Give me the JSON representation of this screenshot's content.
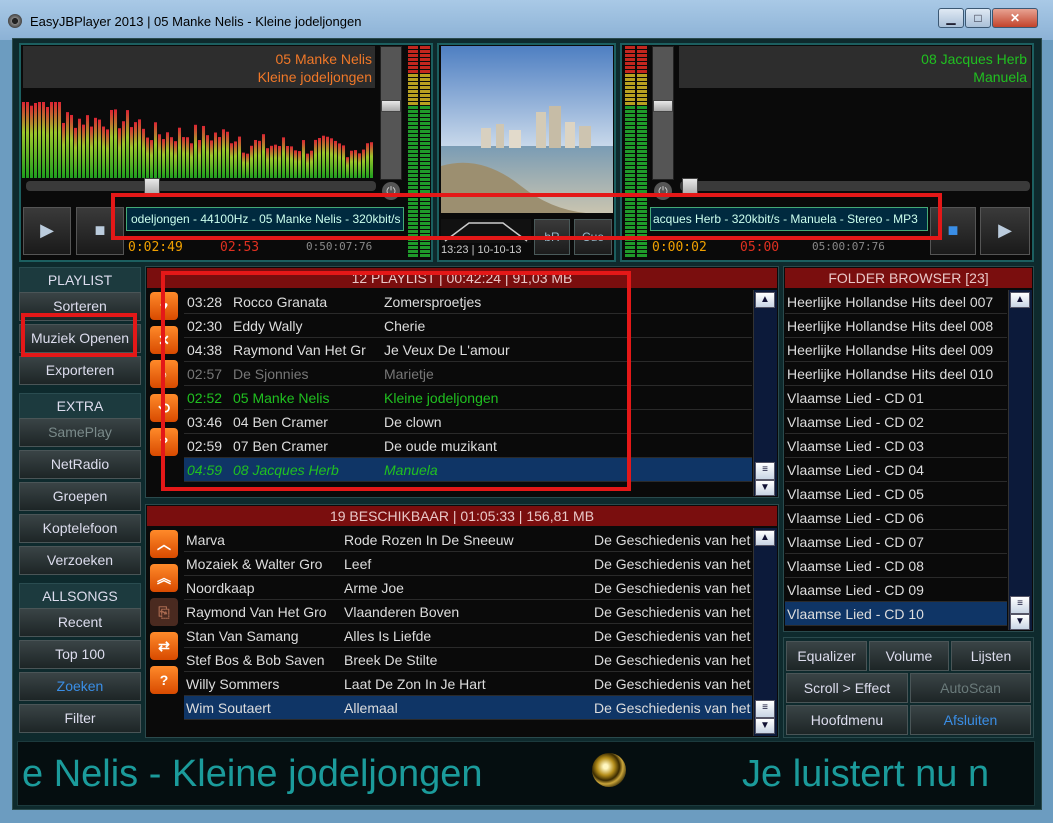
{
  "window": {
    "title": "EasyJBPlayer 2013 | 05 Manke Nelis - Kleine jodeljongen",
    "minimize": "▁",
    "maximize": "□",
    "close": "✕"
  },
  "deck_left": {
    "artist": "05 Manke Nelis",
    "title": "Kleine jodeljongen",
    "ticker": "odeljongen - 44100Hz - 05 Manke Nelis - 320kbit/s",
    "play_icon": "▶",
    "stop_icon": "■",
    "time_elapsed": "0:02:49",
    "time_total": "02:53",
    "time_remain": "0:50:07:76",
    "power_icon": "⏻"
  },
  "deck_right": {
    "artist": "08 Jacques Herb",
    "title": "Manuela",
    "ticker": "acques Herb - 320kbit/s - Manuela - Stereo - MP3",
    "play_icon": "▶",
    "stop_icon": "■",
    "time_elapsed": "0:00:02",
    "time_total": "05:00",
    "time_remain": "05:00:07:76",
    "power_icon": "⏻"
  },
  "center": {
    "clock": "13:23 | 10-10-13",
    "btn_br": "bR",
    "btn_cue": "Cue"
  },
  "playlist_menu": {
    "header": "PLAYLIST",
    "items": [
      "Sorteren",
      "Muziek Openen",
      "Exporteren"
    ]
  },
  "extra_menu": {
    "header": "EXTRA",
    "items": [
      "SamePlay",
      "NetRadio",
      "Groepen",
      "Koptelefoon",
      "Verzoeken"
    ]
  },
  "allsongs_menu": {
    "header": "ALLSONGS",
    "items": [
      "Recent",
      "Top 100",
      "Zoeken",
      "Filter"
    ]
  },
  "playlist": {
    "header": "12 PLAYLIST | 00:42:24 | 91,03 MB",
    "rows": [
      {
        "time": "03:28",
        "artist": "Rocco Granata",
        "title": "Zomersproetjes"
      },
      {
        "time": "02:30",
        "artist": "Eddy Wally",
        "title": "Cherie"
      },
      {
        "time": "04:38",
        "artist": "Raymond Van Het Gr",
        "title": "Je Veux De L'amour"
      },
      {
        "time": "02:57",
        "artist": "De Sjonnies",
        "title": "Marietje"
      },
      {
        "time": "02:52",
        "artist": "05 Manke Nelis",
        "title": "Kleine jodeljongen"
      },
      {
        "time": "03:46",
        "artist": "04 Ben Cramer",
        "title": "De clown"
      },
      {
        "time": "02:59",
        "artist": "07 Ben Cramer",
        "title": "De oude muzikant"
      },
      {
        "time": "04:59",
        "artist": "08 Jacques Herb",
        "title": "Manuela"
      }
    ],
    "side_icons": [
      "♥",
      "✕",
      "♪",
      "⟲",
      "?"
    ],
    "scroll_up": "▲",
    "scroll_down": "▼",
    "scroll_grip": "≡"
  },
  "available": {
    "header": "19 BESCHIKBAAR | 01:05:33 | 156,81 MB",
    "rows": [
      {
        "artist": "Marva",
        "title": "Rode Rozen In De Sneeuw",
        "album": "De Geschiedenis van het"
      },
      {
        "artist": "Mozaiek & Walter Gro",
        "title": "Leef",
        "album": "De Geschiedenis van het"
      },
      {
        "artist": "Noordkaap",
        "title": "Arme Joe",
        "album": "De Geschiedenis van het"
      },
      {
        "artist": "Raymond Van Het Gro",
        "title": "Vlaanderen Boven",
        "album": "De Geschiedenis van het"
      },
      {
        "artist": "Stan Van Samang",
        "title": "Alles Is Liefde",
        "album": "De Geschiedenis van het"
      },
      {
        "artist": "Stef Bos & Bob Saven",
        "title": "Breek De Stilte",
        "album": "De Geschiedenis van het"
      },
      {
        "artist": "Willy Sommers",
        "title": "Laat De Zon In Je Hart",
        "album": "De Geschiedenis van het"
      },
      {
        "artist": "Wim Soutaert",
        "title": "Allemaal",
        "album": "De Geschiedenis van het"
      }
    ],
    "side_icons": [
      "︿",
      "︽",
      "⎘",
      "⇄",
      "?"
    ],
    "scroll_up": "▲",
    "scroll_down": "▼",
    "scroll_grip": "≡"
  },
  "folders": {
    "header": "FOLDER BROWSER [23]",
    "items": [
      "Heerlijke Hollandse Hits deel 007",
      "Heerlijke Hollandse Hits deel 008",
      "Heerlijke Hollandse Hits deel 009",
      "Heerlijke Hollandse Hits deel 010",
      "Vlaamse Lied - CD 01",
      "Vlaamse Lied - CD 02",
      "Vlaamse Lied - CD 03",
      "Vlaamse Lied - CD 04",
      "Vlaamse Lied - CD 05",
      "Vlaamse Lied - CD 06",
      "Vlaamse Lied - CD 07",
      "Vlaamse Lied - CD 08",
      "Vlaamse Lied - CD 09",
      "Vlaamse Lied - CD 10"
    ],
    "scroll_up": "▲",
    "scroll_down": "▼",
    "scroll_grip": "≡"
  },
  "bottom_buttons": {
    "equalizer": "Equalizer",
    "volume": "Volume",
    "lijsten": "Lijsten",
    "scroll_effect": "Scroll > Effect",
    "autoscan": "AutoScan",
    "hoofdmenu": "Hoofdmenu",
    "afsluiten": "Afsluiten"
  },
  "marquee": {
    "text_a": "e Nelis - Kleine jodeljongen",
    "text_b": "Je luistert nu n"
  },
  "colors": {
    "accent_orange": "#f07828",
    "accent_green": "#20c020",
    "header_red": "#7a0e0e",
    "highlight_blue": "#0f3566",
    "marquee_teal": "#1b9b9b"
  }
}
